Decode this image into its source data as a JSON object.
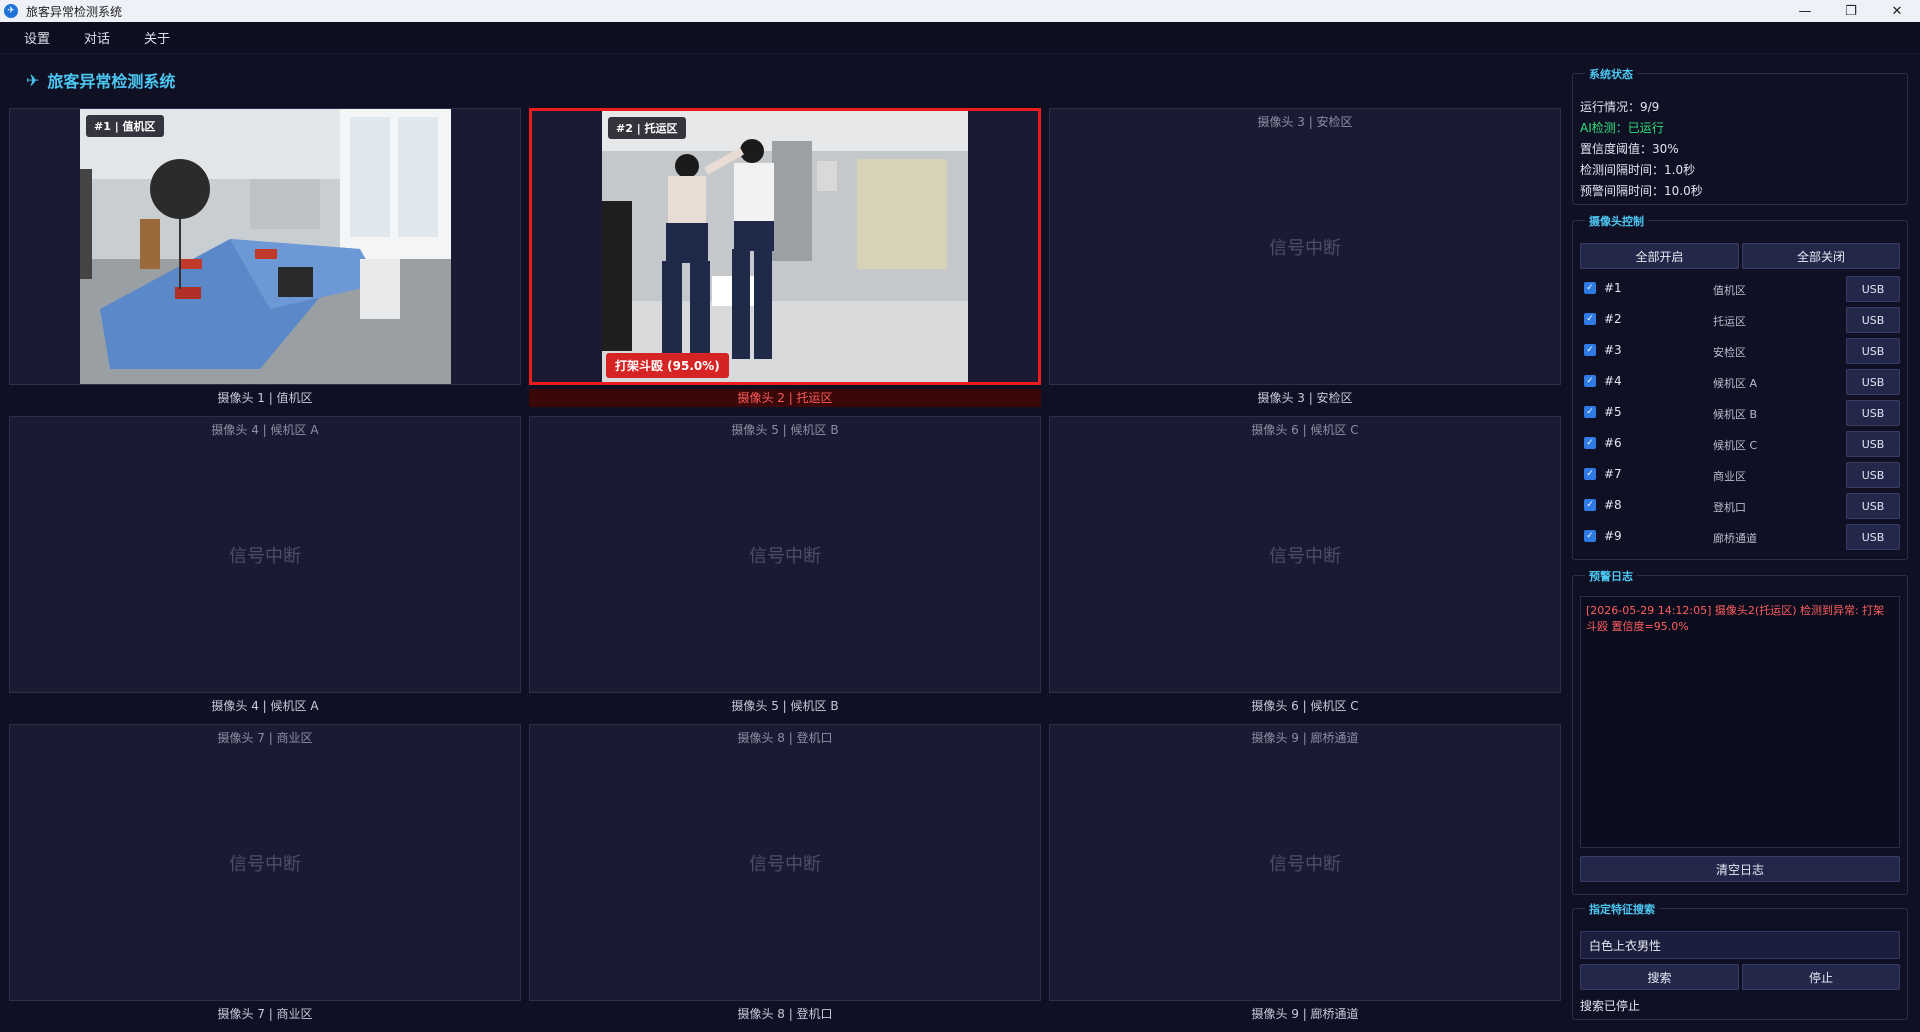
{
  "window": {
    "title": "旅客异常检测系统",
    "minimize": "—",
    "restore": "❐",
    "close": "✕"
  },
  "menu": [
    "设置",
    "对话",
    "关于"
  ],
  "header": {
    "icon": "✈",
    "title": "旅客异常检测系统"
  },
  "cameras": [
    {
      "overlay": "#1 | 值机区",
      "caption": "摄像头 1 | 值机区",
      "top_label": "",
      "signal": "",
      "alarm_text": ""
    },
    {
      "overlay": "#2 | 托运区",
      "caption": "摄像头 2 | 托运区",
      "top_label": "",
      "signal": "",
      "alarm_text": "打架斗殴 (95.0%)"
    },
    {
      "overlay": "",
      "caption": "摄像头 3 | 安检区",
      "top_label": "摄像头 3 | 安检区",
      "signal": "信号中断",
      "alarm_text": ""
    },
    {
      "overlay": "",
      "caption": "摄像头 4 | 候机区 A",
      "top_label": "摄像头 4 | 候机区 A",
      "signal": "信号中断",
      "alarm_text": ""
    },
    {
      "overlay": "",
      "caption": "摄像头 5 | 候机区 B",
      "top_label": "摄像头 5 | 候机区 B",
      "signal": "信号中断",
      "alarm_text": ""
    },
    {
      "overlay": "",
      "caption": "摄像头 6 | 候机区 C",
      "top_label": "摄像头 6 | 候机区 C",
      "signal": "信号中断",
      "alarm_text": ""
    },
    {
      "overlay": "",
      "caption": "摄像头 7 | 商业区",
      "top_label": "摄像头 7 | 商业区",
      "signal": "信号中断",
      "alarm_text": ""
    },
    {
      "overlay": "",
      "caption": "摄像头 8 | 登机口",
      "top_label": "摄像头 8 | 登机口",
      "signal": "信号中断",
      "alarm_text": ""
    },
    {
      "overlay": "",
      "caption": "摄像头 9 | 廊桥通道",
      "top_label": "摄像头 9 | 廊桥通道",
      "signal": "信号中断",
      "alarm_text": ""
    }
  ],
  "system_status": {
    "title": "系统状态",
    "running": "运行情况：9/9",
    "ai": "AI检测：已运行",
    "threshold": "置信度阈值：30%",
    "detect_interval": "检测间隔时间：1.0秒",
    "alert_interval": "预警间隔时间：10.0秒"
  },
  "camera_control": {
    "title": "摄像头控制",
    "all_on": "全部开启",
    "all_off": "全部关闭",
    "rows": [
      {
        "id": "#1",
        "zone": "值机区",
        "source": "USB"
      },
      {
        "id": "#2",
        "zone": "托运区",
        "source": "USB"
      },
      {
        "id": "#3",
        "zone": "安检区",
        "source": "USB"
      },
      {
        "id": "#4",
        "zone": "候机区 A",
        "source": "USB"
      },
      {
        "id": "#5",
        "zone": "候机区 B",
        "source": "USB"
      },
      {
        "id": "#6",
        "zone": "候机区 C",
        "source": "USB"
      },
      {
        "id": "#7",
        "zone": "商业区",
        "source": "USB"
      },
      {
        "id": "#8",
        "zone": "登机口",
        "source": "USB"
      },
      {
        "id": "#9",
        "zone": "廊桥通道",
        "source": "USB"
      }
    ]
  },
  "alert_log": {
    "title": "预警日志",
    "entries": [
      "[2026-05-29 14:12:05] 摄像头2(托运区) 检测到异常: 打架斗殴 置信度=95.0%"
    ],
    "clear": "清空日志"
  },
  "feature_search": {
    "title": "指定特征搜索",
    "value": "白色上衣男性",
    "search": "搜索",
    "stop": "停止",
    "status": "搜索已停止"
  },
  "colors": {
    "accent": "#4cc7f2",
    "alarm": "#ee1d1d",
    "ok": "#2fe07b",
    "background": "#0f1024"
  }
}
